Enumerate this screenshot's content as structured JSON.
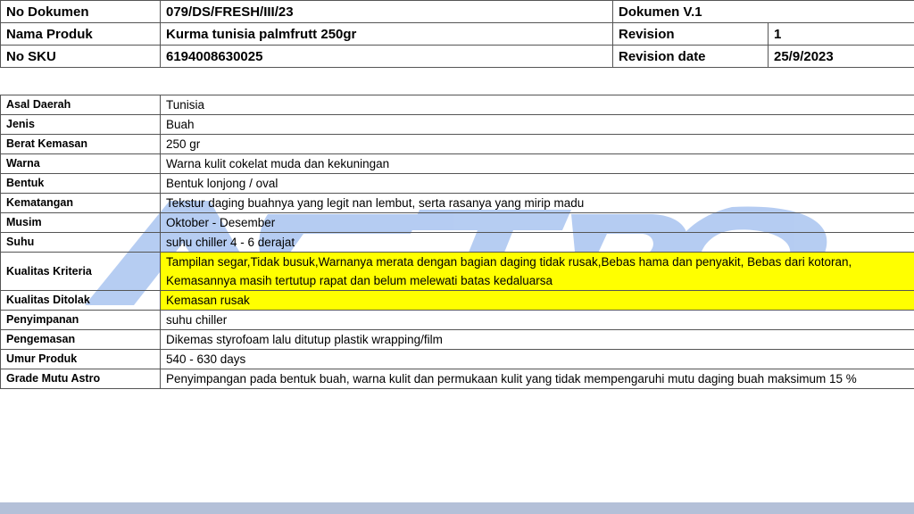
{
  "header": {
    "doc_no_label": "No Dokumen",
    "doc_no_value": "079/DS/FRESH/III/23",
    "doc_version": "Dokumen V.1",
    "product_label": "Nama Produk",
    "product_value": "Kurma tunisia palmfrutt 250gr",
    "revision_label": "Revision",
    "revision_value": "1",
    "sku_label": "No SKU",
    "sku_value": "6194008630025",
    "revision_date_label": "Revision date",
    "revision_date_value": "25/9/2023"
  },
  "specs": [
    {
      "label": "Asal Daerah",
      "value": "Tunisia"
    },
    {
      "label": "Jenis",
      "value": "Buah"
    },
    {
      "label": "Berat Kemasan",
      "value": "250  gr"
    },
    {
      "label": "Warna",
      "value": "Warna kulit  cokelat muda dan kekuningan"
    },
    {
      "label": "Bentuk",
      "value": "Bentuk lonjong / oval"
    },
    {
      "label": "Kematangan",
      "value": "Tekstur daging buahnya yang legit nan lembut, serta rasanya yang mirip madu"
    },
    {
      "label": "Musim",
      "value": "Oktober - Desember"
    },
    {
      "label": "Suhu",
      "value": "suhu chiller 4 - 6 derajat"
    },
    {
      "label": "Kualitas Kriteria",
      "value_line1": "Tampilan segar,Tidak busuk,Warnanya merata dengan bagian daging tidak rusak,Bebas hama dan penyakit, Bebas dari kotoran,",
      "value_line2": "Kemasannya masih tertutup rapat dan belum melewati batas kedaluarsa"
    },
    {
      "label": "Kualitas Ditolak",
      "value": "Kemasan rusak"
    },
    {
      "label": "Penyimpanan",
      "value": "suhu chiller"
    },
    {
      "label": "Pengemasan",
      "value": "Dikemas styrofoam lalu ditutup plastik wrapping/film"
    },
    {
      "label": "Umur Produk",
      "value": "540 - 630 days"
    },
    {
      "label": "Grade Mutu Astro",
      "value": "Penyimpangan pada bentuk buah, warna kulit dan permukaan kulit yang tidak mempengaruhi mutu daging buah maksimum 15 %"
    }
  ],
  "colors": {
    "highlight": "#ffff00",
    "watermark": "#a9c4f0",
    "footer_bar": "#b4c0d8"
  }
}
